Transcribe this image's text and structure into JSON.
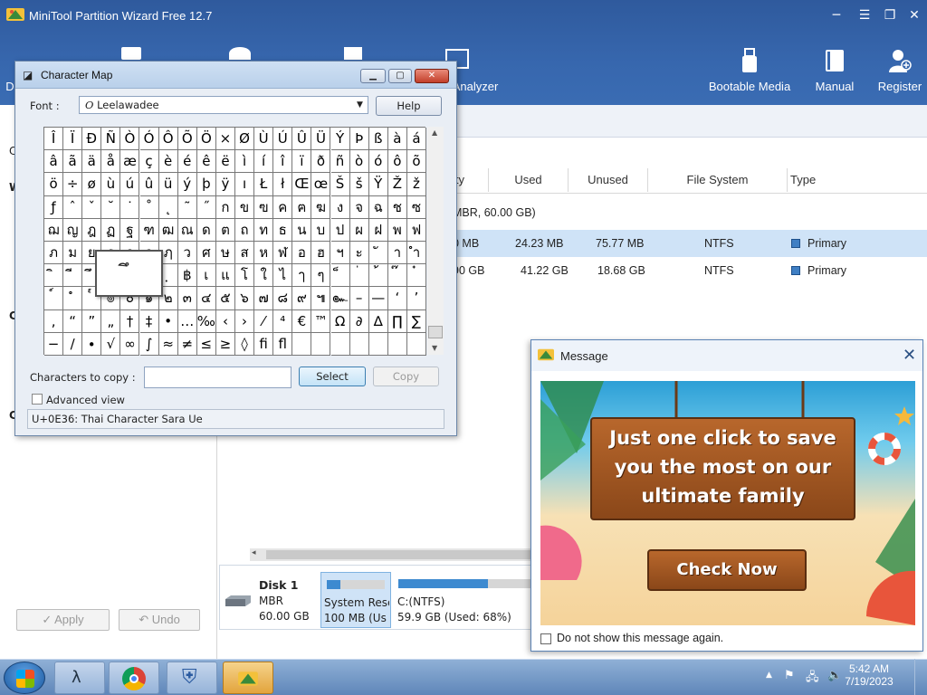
{
  "app": {
    "title": "MiniTool Partition Wizard Free 12.7"
  },
  "toolbar": {
    "items": [
      {
        "label": "D",
        "icon": "disk-icon"
      },
      {
        "label": "Analyzer",
        "icon": "space-analyzer-icon"
      },
      {
        "label": "Bootable Media",
        "icon": "usb-icon"
      },
      {
        "label": "Manual",
        "icon": "book-icon"
      },
      {
        "label": "Register",
        "icon": "user-add-icon"
      }
    ]
  },
  "table": {
    "headers": [
      "ity",
      "Used",
      "Unused",
      "File System",
      "Type"
    ],
    "disk_row": "MBR, 60.00 GB)",
    "rows": [
      {
        "capacity": "0 MB",
        "used": "24.23 MB",
        "unused": "75.77 MB",
        "fs": "NTFS",
        "type": "Primary"
      },
      {
        "capacity": "90 GB",
        "used": "41.22 GB",
        "unused": "18.68 GB",
        "fs": "NTFS",
        "type": "Primary"
      }
    ]
  },
  "left": {
    "apply_label": "Apply",
    "undo_label": "Undo",
    "letters": [
      "C",
      "W",
      "C",
      "C"
    ]
  },
  "diskmap": {
    "disk_name": "Disk 1",
    "disk_type": "MBR",
    "disk_size": "60.00 GB",
    "parts": [
      {
        "name": "System Rese",
        "detail": "100 MB (Us",
        "fill": 0.24
      },
      {
        "name": "C:(NTFS)",
        "detail": "59.9 GB (Used: 68%)",
        "fill": 0.68
      }
    ]
  },
  "charmap": {
    "title": "Character Map",
    "font_label": "Font :",
    "font_value": "Leelawadee",
    "help_label": "Help",
    "grid": [
      "Î",
      "Ï",
      "Ð",
      "Ñ",
      "Ò",
      "Ó",
      "Ô",
      "Õ",
      "Ö",
      "×",
      "Ø",
      "Ù",
      "Ú",
      "Û",
      "Ü",
      "Ý",
      "Þ",
      "ß",
      "à",
      "á",
      "â",
      "ã",
      "ä",
      "å",
      "æ",
      "ç",
      "è",
      "é",
      "ê",
      "ë",
      "ì",
      "í",
      "î",
      "ï",
      "ð",
      "ñ",
      "ò",
      "ó",
      "ô",
      "õ",
      "ö",
      "÷",
      "ø",
      "ù",
      "ú",
      "û",
      "ü",
      "ý",
      "þ",
      "ÿ",
      "ı",
      "Ł",
      "ł",
      "Œ",
      "œ",
      "Š",
      "š",
      "Ÿ",
      "Ž",
      "ž",
      "ƒ",
      "ˆ",
      "ˇ",
      "˘",
      "˙",
      "˚",
      "˛",
      "˜",
      "˝",
      "ก",
      "ข",
      "ฃ",
      "ค",
      "ฅ",
      "ฆ",
      "ง",
      "จ",
      "ฉ",
      "ช",
      "ซ",
      "ฌ",
      "ญ",
      "ฎ",
      "ฏ",
      "ฐ",
      "ฑ",
      "ฒ",
      "ณ",
      "ด",
      "ต",
      "ถ",
      "ท",
      "ธ",
      "น",
      "บ",
      "ป",
      "ผ",
      "ฝ",
      "พ",
      "ฟ",
      "ภ",
      "ม",
      "ย",
      "ร",
      "ฤ",
      "ล",
      "ฦ",
      "ว",
      "ศ",
      "ษ",
      "ส",
      "ห",
      "ฬ",
      "อ",
      "ฮ",
      "ฯ",
      "ะ",
      "ั",
      "า",
      "ำ",
      "ิ",
      "ี",
      "ึ",
      "ื",
      "ุ",
      "ู",
      "ฺ",
      "฿",
      "เ",
      "แ",
      "โ",
      "ใ",
      "ไ",
      "ๅ",
      "ๆ",
      "็",
      "่",
      "้",
      "๊",
      "๋",
      "์",
      "ํ",
      "๎",
      "๏",
      "๐",
      "๑",
      "๒",
      "๓",
      "๔",
      "๕",
      "๖",
      "๗",
      "๘",
      "๙",
      "๚",
      "๛",
      "–",
      "—",
      "‘",
      "’",
      "‚",
      "“",
      "”",
      "„",
      "†",
      "‡",
      "•",
      "…",
      "‰",
      "‹",
      "›",
      "⁄",
      "⁴",
      "€",
      "™",
      "Ω",
      "∂",
      "∆",
      "∏",
      "∑",
      "−",
      "∕",
      "∙",
      "√",
      "∞",
      "∫",
      "≈",
      "≠",
      "≤",
      "≥",
      "◊",
      "ﬁ",
      "ﬂ",
      "",
      "",
      "",
      "",
      "",
      "",
      ""
    ],
    "zoom_char": "ึ",
    "copy_label": "Characters to copy :",
    "copy_value": "",
    "select_label": "Select",
    "copy_btn_label": "Copy",
    "advanced_label": "Advanced view",
    "status": "U+0E36: Thai Character Sara Ue"
  },
  "message": {
    "title": "Message",
    "headline_1": "Just one click to save",
    "headline_2": "you the most on our",
    "headline_3": "ultimate family",
    "cta": "Check Now",
    "dont_show": "Do not show this message again."
  },
  "taskbar": {
    "time": "5:42 AM",
    "date": "7/19/2023"
  }
}
